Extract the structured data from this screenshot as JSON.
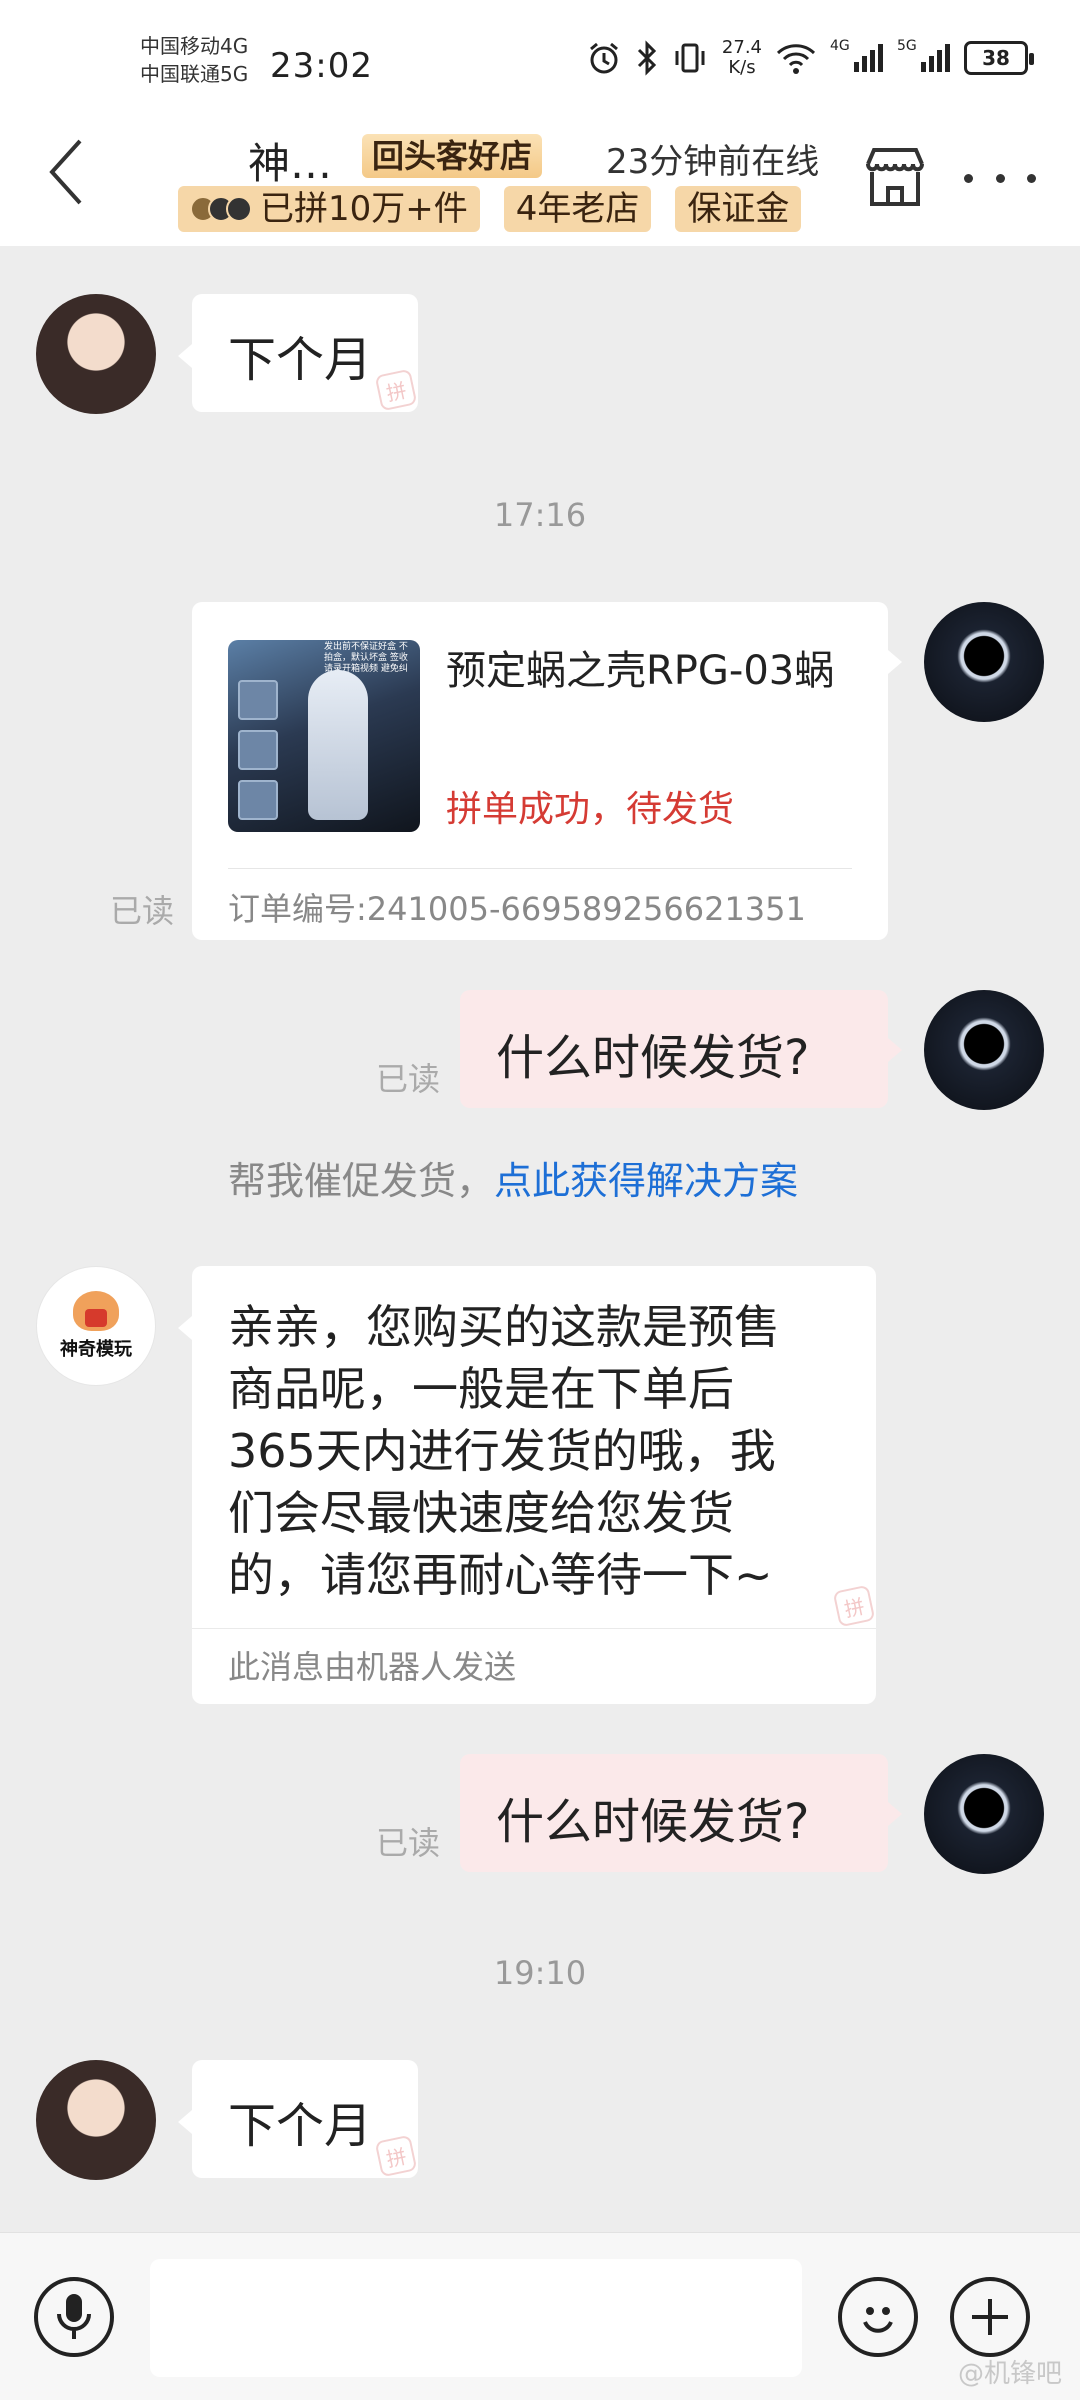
{
  "status_bar": {
    "carrier_1": "中国移动4G",
    "carrier_2": "中国联通5G",
    "time": "23:02",
    "net_speed_value": "27.4",
    "net_speed_unit": "K/s",
    "signal_1_label": "4G",
    "signal_2_label": "5G",
    "battery": "38"
  },
  "header": {
    "shop_name": "神…",
    "badge": "回头客好店",
    "online_status": "23分钟前在线",
    "chips": [
      "已拼10万+件",
      "4年老店",
      "保证金"
    ]
  },
  "messages": {
    "m1_text": "下个月",
    "t1": "17:16",
    "order_card": {
      "title": "预定蜗之壳RPG-03蜗",
      "status": "拼单成功，待发货",
      "order_no": "订单编号:241005-669589256621351",
      "read": "已读",
      "image_note": "发出前不保证好盒 不拍盒，默认坏盒 签收请录开箱视频 避免纠纷"
    },
    "m2_text": "什么时候发货?",
    "m2_read": "已读",
    "hint_prefix": "帮我催促发货，",
    "hint_link": "点此获得解决方案",
    "bot_lines": [
      "亲亲，您购买的这款是预售",
      "商品呢，一般是在下单后",
      "365天内进行发货的哦，我",
      "们会尽最快速度给您发货",
      "的，请您再耐心等待一下~"
    ],
    "bot_note": "此消息由机器人发送",
    "shop_avatar_label": "神奇模玩",
    "m3_text": "什么时候发货?",
    "m3_read": "已读",
    "t2": "19:10",
    "m4_text": "下个月",
    "pdd_mark": "拼"
  },
  "footer": {
    "watermark": "@机锋吧"
  },
  "colors": {
    "accent_red": "#d53b34",
    "link_blue": "#1d6fd6",
    "badge_gold": "#f6d7a8",
    "sent_bubble": "#fbe9ea"
  },
  "icons": [
    "back-icon",
    "alarm-icon",
    "bluetooth-icon",
    "vibrate-icon",
    "wifi-icon",
    "signal-icon",
    "store-icon",
    "more-icon",
    "microphone-icon",
    "emoji-icon",
    "plus-icon"
  ]
}
